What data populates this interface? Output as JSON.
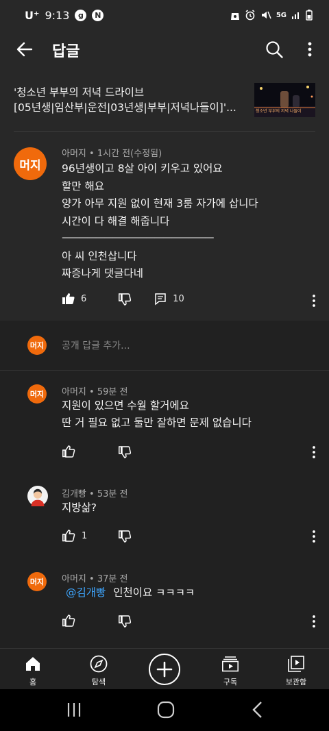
{
  "status_bar": {
    "carrier": "U⁺",
    "time": "9:13",
    "icon_g": "g",
    "icon_n": "N",
    "network": "5G"
  },
  "header": {
    "title": "답글"
  },
  "video": {
    "title_line1": "'청소년 부부의 저녁 드라이브",
    "title_line2": "[05년생|임산부|운전|03년생|부부|저녁나들이]'...",
    "thumb_caption": "청소년 부부의 저녁 나들이"
  },
  "parent_comment": {
    "avatar_text": "머지",
    "author": "아머지",
    "time": "1시간 전(수정됨)",
    "lines": [
      "96년생이고 8살 아이 키우고 있어요",
      "할만 해요",
      "양가 아무 지원 없이 현재 3룸 자가에 삽니다",
      "시간이 다 해결 해줍니다",
      "ㅡㅡㅡㅡㅡㅡㅡㅡㅡㅡㅡㅡㅡㅡㅡㅡㅡㅡ",
      "아 씨 인천삽니다",
      "짜증나게 댓글다네"
    ],
    "likes": "6",
    "replies": "10"
  },
  "add_reply": {
    "avatar_text": "머지",
    "placeholder": "공개 답글 추가..."
  },
  "replies": [
    {
      "avatar_text": "머지",
      "author": "아머지",
      "time": "59분 전",
      "lines": [
        "지원이 있으면 수월 할거에요",
        "딴 거 필요 없고 둘만 잘하면 문제 없습니다"
      ],
      "likes": ""
    },
    {
      "avatar_text": "",
      "author": "김개빵",
      "time": "53분 전",
      "lines": [
        "지방삶?"
      ],
      "likes": "1"
    },
    {
      "avatar_text": "머지",
      "author": "아머지",
      "time": "37분 전",
      "mention": "@김개빵",
      "text": "인천이요 ㅋㅋㅋㅋ",
      "likes": ""
    }
  ],
  "bottom_nav": {
    "home": "홈",
    "explore": "탐색",
    "subscriptions": "구독",
    "library": "보관함"
  }
}
